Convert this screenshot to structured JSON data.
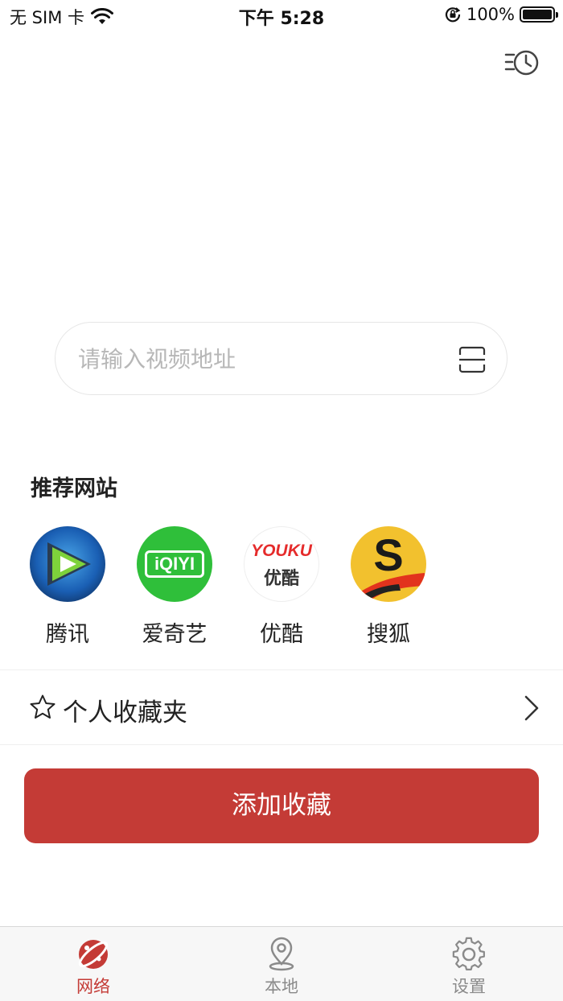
{
  "status_bar": {
    "carrier": "无 SIM 卡",
    "time": "下午 5:28",
    "battery_percent": "100%",
    "battery_level": 1.0
  },
  "header": {
    "history_icon": "history-list-clock-icon"
  },
  "search": {
    "placeholder": "请输入视频地址",
    "value": "",
    "scan_icon": "scan-icon"
  },
  "recommended": {
    "title": "推荐网站",
    "sites": [
      {
        "label": "腾讯",
        "icon": "tencent-video-logo",
        "color": "#1a5fb4"
      },
      {
        "label": "爱奇艺",
        "icon": "iqiyi-logo",
        "color": "#2fbf3a",
        "logo_text": "iQIYI"
      },
      {
        "label": "优酷",
        "icon": "youku-logo",
        "color": "#e52b2b",
        "logo_text_top": "YOUKU",
        "logo_text_bottom": "优酷"
      },
      {
        "label": "搜狐",
        "icon": "sohu-logo",
        "color": "#f2c12e",
        "logo_text": "S"
      }
    ]
  },
  "favorites": {
    "label": "个人收藏夹",
    "star_icon": "star-outline-icon",
    "chevron_icon": "chevron-right-icon"
  },
  "add_button": {
    "label": "添加收藏"
  },
  "tab_bar": {
    "tabs": [
      {
        "label": "网络",
        "icon": "network-planet-icon",
        "active": true
      },
      {
        "label": "本地",
        "icon": "location-pin-icon",
        "active": false
      },
      {
        "label": "设置",
        "icon": "gear-icon",
        "active": false
      }
    ]
  },
  "colors": {
    "accent": "#c43b36",
    "inactive_tab": "#8a8a8a",
    "placeholder": "#b7b7b7"
  }
}
